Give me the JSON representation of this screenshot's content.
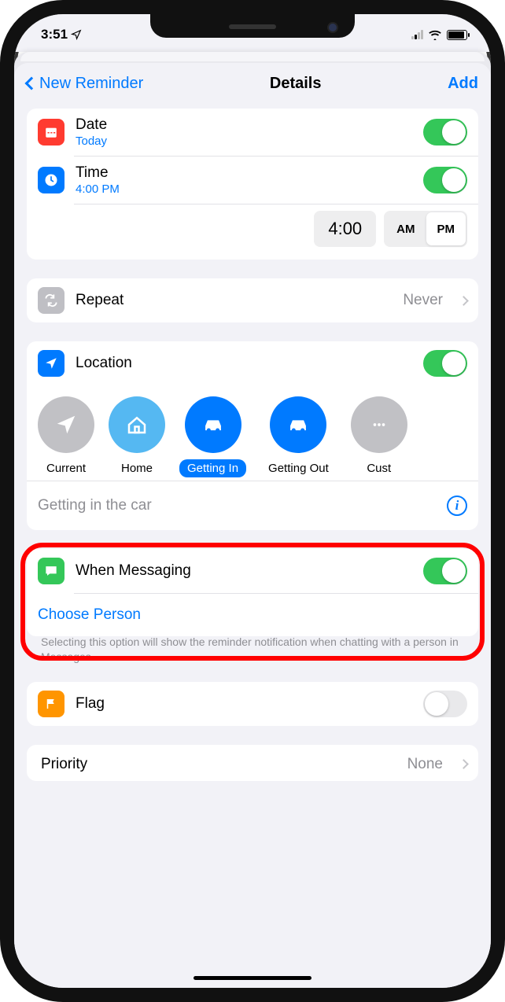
{
  "status": {
    "time": "3:51",
    "loc_arrow": "➤"
  },
  "nav": {
    "back": "New Reminder",
    "title": "Details",
    "action": "Add"
  },
  "date": {
    "label": "Date",
    "value": "Today",
    "on": true
  },
  "time": {
    "label": "Time",
    "value": "4:00 PM",
    "on": true,
    "picker": "4:00",
    "am": "AM",
    "pm": "PM",
    "sel": "PM"
  },
  "repeat": {
    "label": "Repeat",
    "value": "Never"
  },
  "location": {
    "label": "Location",
    "on": true,
    "items": [
      {
        "label": "Current"
      },
      {
        "label": "Home"
      },
      {
        "label": "Getting In",
        "sel": true
      },
      {
        "label": "Getting Out"
      },
      {
        "label": "Cust"
      }
    ],
    "detail": "Getting in the car"
  },
  "messaging": {
    "label": "When Messaging",
    "on": true,
    "choose": "Choose Person",
    "footer": "Selecting this option will show the reminder notification when chatting with a person in Messages."
  },
  "flag": {
    "label": "Flag",
    "on": false
  },
  "priority": {
    "label": "Priority",
    "value": "None"
  }
}
